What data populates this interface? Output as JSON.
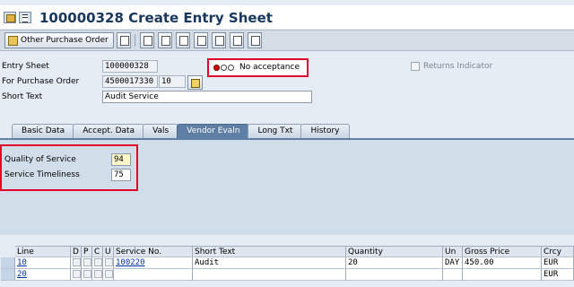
{
  "title": "100000328 Create Entry Sheet",
  "toolbar": {
    "other_po_label": "Other Purchase Order"
  },
  "header": {
    "entry_sheet_label": "Entry Sheet",
    "entry_sheet_value": "100000328",
    "po_label": "For Purchase Order",
    "po_value": "4500017330",
    "po_item": "10",
    "short_text_label": "Short Text",
    "short_text_value": "Audit Service",
    "status_text": "No acceptance",
    "returns_indicator_label": "Returns Indicator"
  },
  "tabs": [
    {
      "label": "Basic Data"
    },
    {
      "label": "Accept. Data"
    },
    {
      "label": "Vals"
    },
    {
      "label": "Vendor Evaln",
      "active": true
    },
    {
      "label": "Long Txt"
    },
    {
      "label": "History"
    }
  ],
  "vendor_eval": {
    "quality_label": "Quality of Service",
    "quality_value": "94",
    "timeliness_label": "Service Timeliness",
    "timeliness_value": "75"
  },
  "table": {
    "headers": [
      "Line",
      "D",
      "P",
      "C",
      "U",
      "Service No.",
      "Short Text",
      "Quantity",
      "Un",
      "Gross Price",
      "Crcy"
    ],
    "rows": [
      {
        "line": "10",
        "service_no": "100220",
        "short_text": "Audit",
        "quantity": "20",
        "unit": "DAY",
        "gross_price": "450.00",
        "currency": "EUR"
      },
      {
        "line": "20",
        "service_no": "",
        "short_text": "",
        "quantity": "",
        "unit": "",
        "gross_price": "",
        "currency": "EUR"
      }
    ]
  },
  "colors": {
    "highlight_border": "#e0002a",
    "active_tab": "#5f7fa4",
    "title_text": "#17375e"
  }
}
